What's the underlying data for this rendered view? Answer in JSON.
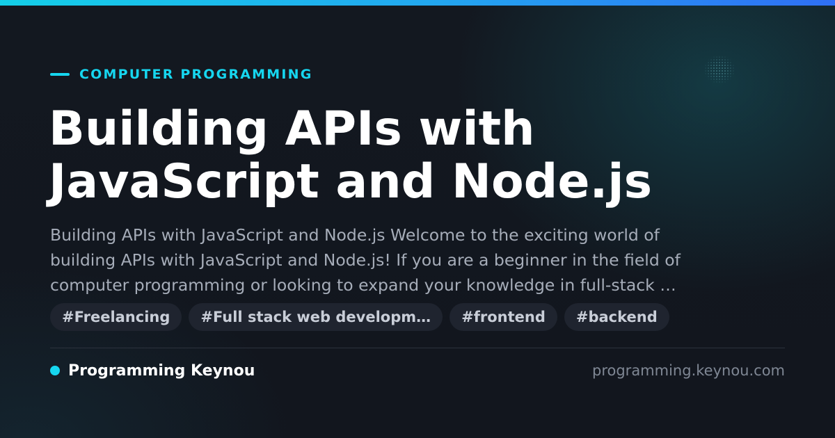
{
  "category": "COMPUTER PROGRAMMING",
  "title_lines": [
    "Building APIs with",
    "JavaScript and Node.js"
  ],
  "excerpt_lines": [
    "Building APIs with JavaScript and Node.js Welcome to the exciting world of",
    "building APIs with JavaScript and Node.js! If you are a beginner in the field of",
    "computer programming or looking to expand your knowledge in full-stack …"
  ],
  "tags": [
    "#Freelancing",
    "#Full stack web developm…",
    "#frontend",
    "#backend"
  ],
  "brand": {
    "name": "Programming Keynou",
    "domain": "programming.keynou.com"
  },
  "colors": {
    "accent": "#16d6ef",
    "background": "#131820",
    "tag_background": "#1f242f",
    "excerpt_text": "#a6adb9",
    "domain_text": "#7f8794"
  }
}
